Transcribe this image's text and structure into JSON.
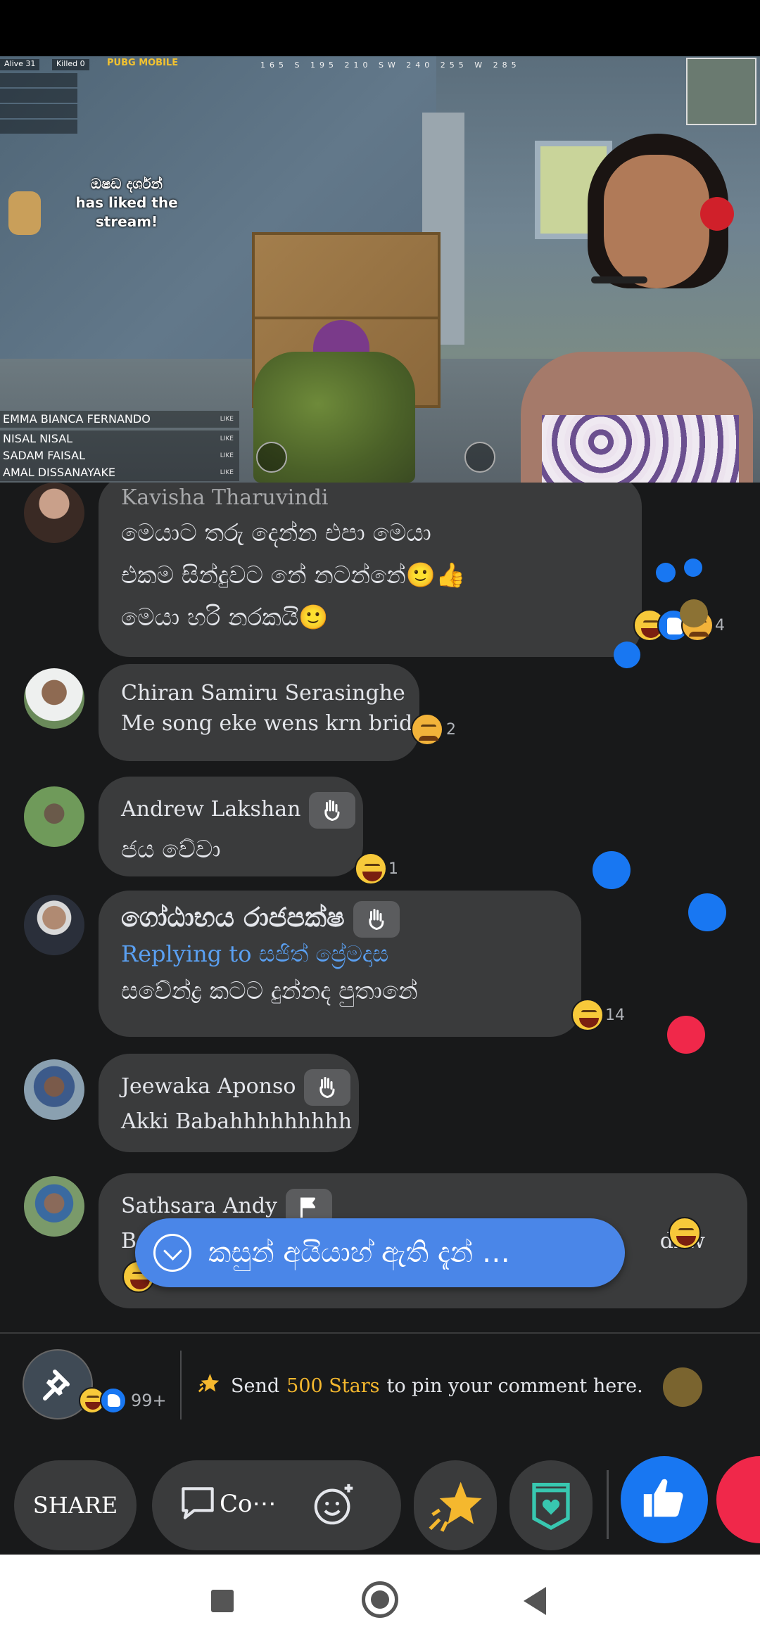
{
  "video": {
    "hud": {
      "alive_label": "Alive",
      "alive_value": "31",
      "killed_label": "Killed",
      "killed_value": "0",
      "brand": "PUBG MOBILE",
      "compass": "165 S 195 210 SW 240 255 W 285"
    },
    "liked_overlay": {
      "name": "ඔෂඩ දර්ශන්",
      "message": "has liked the stream!"
    },
    "likers": [
      {
        "name": "EMMA BIANCA FERNANDO",
        "tag": "LIKE"
      },
      {
        "name": "NISAL NISAL",
        "tag": "LIKE"
      },
      {
        "name": "SADAM FAISAL",
        "tag": "LIKE"
      },
      {
        "name": "AMAL DISSANAYAKE",
        "tag": "LIKE"
      }
    ]
  },
  "comments": [
    {
      "author": "Kavisha Tharuvindi",
      "lines": [
        "මෙයාට තරු දෙන්න එපා මෙයා",
        "එකම සින්දුවට නේ නටන්නේ🙂👍",
        "මෙයා හරි නරකයි🙂"
      ],
      "reaction_count": "4"
    },
    {
      "author": "Chiran Samiru Serasinghe",
      "lines": [
        "Me song eke wens krn brida"
      ],
      "reaction_count": "2"
    },
    {
      "author": "Andrew Lakshan",
      "lines": [
        "ජය වේවා"
      ],
      "reaction_count": "1"
    },
    {
      "author": "ගෝඨාභය රාජපක්ෂ",
      "reply_prefix": "Replying to",
      "reply_to": "සජිත් ප්‍රේමදාස",
      "lines": [
        "සවේන්ද්‍ර කටට දුන්නද පුතානේ"
      ],
      "reaction_count": "14"
    },
    {
      "author": "Jeewaka Aponso",
      "lines": [
        "Akki Babahhhhhhhhh"
      ],
      "reaction_count": ""
    },
    {
      "author": "Sathsara Andy",
      "lines_start": "B",
      "lines_end": "dnw"
    }
  ],
  "new_comment_pill": {
    "text": "කසුන් අයියාහ් ඇති දැන් …"
  },
  "pin_bar": {
    "reaction_count": "99+",
    "text_before": "Send",
    "stars": "500 Stars",
    "text_after": "to pin your comment here."
  },
  "actions": {
    "share": "SHARE",
    "comment": "Co⋯"
  },
  "colors": {
    "background": "#18191a",
    "bubble": "#3a3b3c",
    "accent_blue": "#1877f2",
    "pill_blue": "#4a86e8",
    "love_red": "#f0284a",
    "stars_gold": "#f5b82e"
  }
}
